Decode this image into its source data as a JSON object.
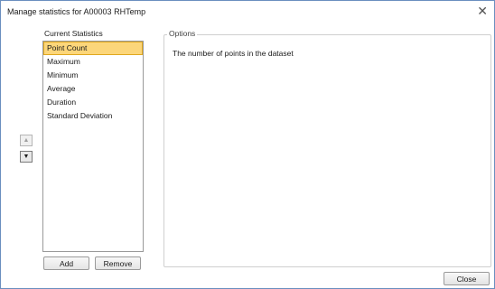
{
  "window": {
    "title": "Manage statistics for A00003 RHTemp",
    "close_glyph": "✕"
  },
  "statistics": {
    "label": "Current Statistics",
    "items": [
      {
        "label": "Point Count",
        "selected": true
      },
      {
        "label": "Maximum",
        "selected": false
      },
      {
        "label": "Minimum",
        "selected": false
      },
      {
        "label": "Average",
        "selected": false
      },
      {
        "label": "Duration",
        "selected": false
      },
      {
        "label": "Standard Deviation",
        "selected": false
      }
    ],
    "selected_color": "#fcd67a",
    "move_up_glyph": "▲",
    "move_down_glyph": "▼",
    "add_label": "Add",
    "remove_label": "Remove"
  },
  "options": {
    "legend": "Options",
    "description": "The number of points in the dataset"
  },
  "footer": {
    "close_label": "Close"
  }
}
